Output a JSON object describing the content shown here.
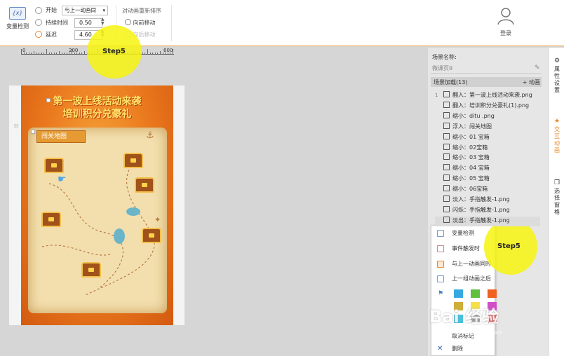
{
  "toolbar": {
    "variable_check_label": "变量检测",
    "variable_check_icon_text": "{x}",
    "start_label": "开始",
    "start_value": "与上一动画同",
    "duration_label": "持续时间",
    "duration_value": "0.50",
    "delay_label": "延迟",
    "delay_value": "4.60",
    "reorder_title": "对动画重新排序",
    "move_forward": "向前移动",
    "move_backward": "向后移动",
    "login_label": "登录"
  },
  "ruler": {
    "labels": [
      "0",
      "200",
      "400",
      "600"
    ]
  },
  "poster": {
    "title_line1": "第一波上线活动来袭",
    "title_line2": "培训积分兑豪礼",
    "map_label": "闯关地图"
  },
  "panel": {
    "scene_name_label": "场景名称:",
    "scene_name_value": "微课页9",
    "anim_header": "场景加载(13)",
    "add_anim": "+ 动画",
    "animations": [
      {
        "num": "1",
        "label": "翻入：第一波上线活动来袭.png"
      },
      {
        "num": "",
        "label": "翻入：培训积分兑豪礼(1).png"
      },
      {
        "num": "",
        "label": "缩小：ditu .png"
      },
      {
        "num": "",
        "label": "浮入：闯关地图"
      },
      {
        "num": "",
        "label": "缩小：01 宝箱"
      },
      {
        "num": "",
        "label": "缩小：02宝箱"
      },
      {
        "num": "",
        "label": "缩小：03 宝箱"
      },
      {
        "num": "",
        "label": "缩小：04 宝箱"
      },
      {
        "num": "",
        "label": "缩小：05 宝箱"
      },
      {
        "num": "",
        "label": "缩小：06宝箱"
      },
      {
        "num": "",
        "label": "淡入：手指触发-1.png"
      },
      {
        "num": "",
        "label": "闪烁：手指触发-1.png"
      },
      {
        "num": "",
        "label": "淡出：手指触发-1.png"
      }
    ]
  },
  "menu": {
    "items": [
      "变量检测",
      "事件触发时",
      "与上一动画同时",
      "上一组动画之后"
    ],
    "cancel_label": "取消标记",
    "delete_label": "删除",
    "colors": [
      "#37a9e0",
      "#5fbf3f",
      "#f0601e",
      "#cfae3a",
      "#f5e04a",
      "#d14ec7",
      "#47c1dc",
      "#a0a0a0",
      "#e64a4a"
    ]
  },
  "side_tabs": [
    {
      "icon": "gear-icon",
      "label": "属性设置"
    },
    {
      "icon": "star-icon",
      "label": "交互动画"
    },
    {
      "icon": "windows-icon",
      "label": "选择窗格"
    }
  ],
  "steps": [
    "Step5",
    "Step5"
  ],
  "watermark": {
    "text": "Bai 经验",
    "sub": "jingyan.baidu.com"
  }
}
